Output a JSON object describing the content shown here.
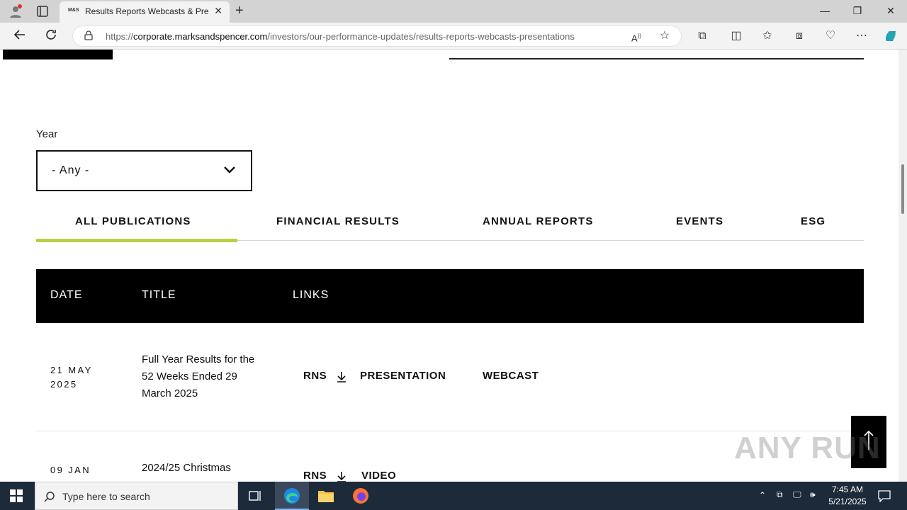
{
  "browser": {
    "tab_title": "Results Reports Webcasts & Pres",
    "tab_favicon_text": "M&S",
    "url_domain": "corporate.marksandspencer.com",
    "url_prefix": "https://",
    "url_path": "/investors/our-performance-updates/results-reports-webcasts-presentations"
  },
  "filter": {
    "year_label": "Year",
    "year_value": "- Any -"
  },
  "tabs": [
    {
      "label": "ALL PUBLICATIONS",
      "active": true
    },
    {
      "label": "FINANCIAL RESULTS"
    },
    {
      "label": "ANNUAL REPORTS"
    },
    {
      "label": "EVENTS"
    },
    {
      "label": "ESG"
    }
  ],
  "table": {
    "headers": [
      "DATE",
      "TITLE",
      "LINKS"
    ],
    "rows": [
      {
        "date_line1": "21 MAY",
        "date_line2": "2025",
        "title": "Full Year Results for the 52 Weeks Ended 29 March 2025",
        "links": [
          "RNS",
          "PRESENTATION",
          "WEBCAST"
        ]
      },
      {
        "date_line1": "09 JAN",
        "title": "2024/25 Christmas",
        "links": [
          "RNS",
          "VIDEO"
        ]
      }
    ]
  },
  "watermark": "ANY RUN",
  "taskbar": {
    "search_placeholder": "Type here to search",
    "time": "7:45 AM",
    "date": "5/21/2025"
  },
  "colors": {
    "accent_underline": "#b5d246",
    "table_header_bg": "#000000"
  }
}
